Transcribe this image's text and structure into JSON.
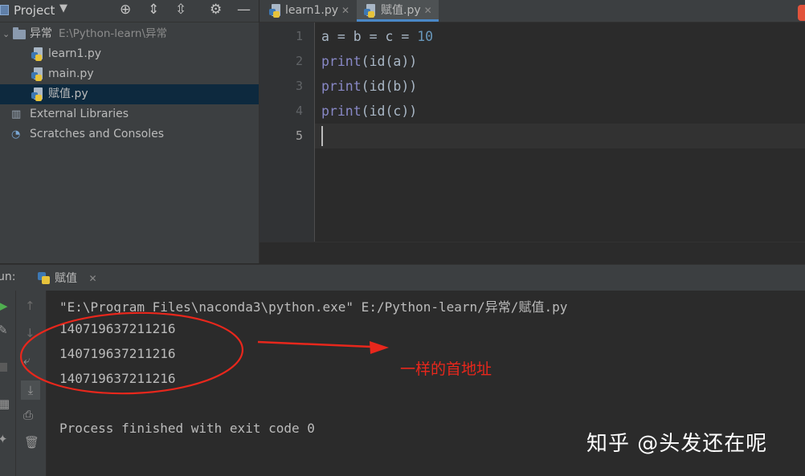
{
  "project_panel": {
    "title": "Project",
    "tree": [
      {
        "label": "异常",
        "path": "E:\\Python-learn\\异常",
        "type": "folder"
      },
      {
        "label": "learn1.py",
        "type": "python-file"
      },
      {
        "label": "main.py",
        "type": "python-file"
      },
      {
        "label": "赋值.py",
        "type": "python-file",
        "selected": true
      },
      {
        "label": "External Libraries",
        "type": "library"
      },
      {
        "label": "Scratches and Consoles",
        "type": "scratch"
      }
    ]
  },
  "editor": {
    "tabs": [
      {
        "label": "learn1.py",
        "active": false
      },
      {
        "label": "赋值.py",
        "active": true
      }
    ],
    "line_numbers": [
      "1",
      "2",
      "3",
      "4",
      "5"
    ],
    "code": [
      {
        "pre": "a = b = c = ",
        "num": "10"
      },
      {
        "kw": "print",
        "rest": "(id(a))"
      },
      {
        "kw": "print",
        "rest": "(id(b))"
      },
      {
        "kw": "print",
        "rest": "(id(c))"
      },
      {
        "pre": ""
      }
    ]
  },
  "run_window": {
    "label": "un:",
    "tab_label": "赋值",
    "output": [
      "\"E:\\Program Files\\naconda3\\python.exe\" E:/Python-learn/异常/赋值.py",
      "140719637211216",
      "140719637211216",
      "140719637211216",
      "",
      "Process finished with exit code 0"
    ]
  },
  "annotation": {
    "text": "一样的首地址",
    "color": "#e8271c"
  },
  "watermark": "知乎 @头发还在呢",
  "colors": {
    "accent": "#4a88c7",
    "keyword": "#8888c6",
    "number": "#6897bb"
  }
}
